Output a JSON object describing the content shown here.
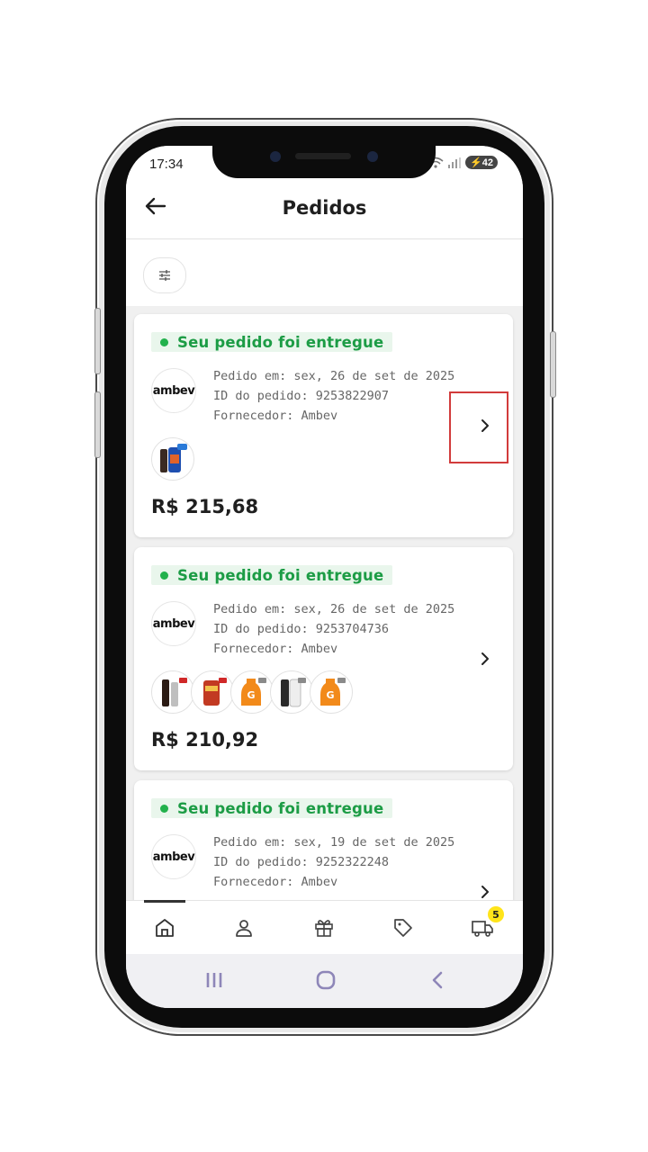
{
  "status_bar": {
    "time": "17:34",
    "battery": "42"
  },
  "header": {
    "title": "Pedidos"
  },
  "orders": [
    {
      "status": "Seu pedido foi entregue",
      "supplier_logo_text": "ambev",
      "date_line": "Pedido em: sex, 26 de set de 2025",
      "id_line": "ID do pedido: 9253822907",
      "supplier_line": "Fornecedor: Ambev",
      "price": "R$ 215,68",
      "product_thumbs": [
        "bottle-can-pack"
      ]
    },
    {
      "status": "Seu pedido foi entregue",
      "supplier_logo_text": "ambev",
      "date_line": "Pedido em: sex, 26 de set de 2025",
      "id_line": "ID do pedido: 9253704736",
      "supplier_line": "Fornecedor: Ambev",
      "price": "R$ 210,92",
      "product_thumbs": [
        "dark-bottles",
        "red-cans",
        "orange-sports-drink",
        "white-cans",
        "orange-sports-drink"
      ]
    },
    {
      "status": "Seu pedido foi entregue",
      "supplier_logo_text": "ambev",
      "date_line": "Pedido em: sex, 19 de set de 2025",
      "id_line": "ID do pedido: 9252322248",
      "supplier_line": "Fornecedor: Ambev"
    }
  ],
  "bottom_nav": {
    "items": [
      "home-icon",
      "user-icon",
      "gift-icon",
      "tag-icon",
      "truck-icon"
    ],
    "truck_badge": "5"
  },
  "colors": {
    "accent_green": "#1c9c45",
    "badge_yellow": "#ffe41a",
    "highlight_red": "#d23b3b"
  }
}
